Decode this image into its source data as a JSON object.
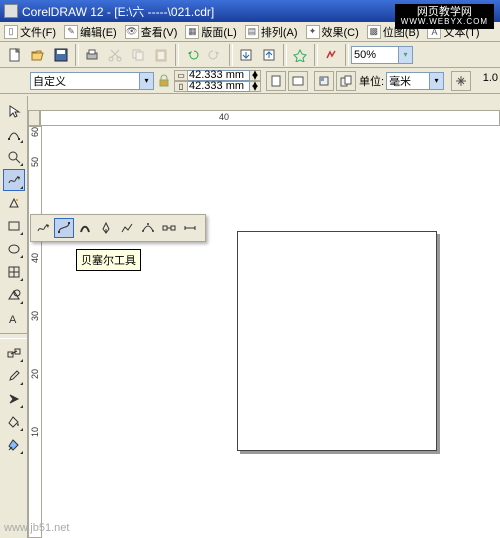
{
  "title": "CorelDRAW 12 - [E:\\六  -----\\021.cdr]",
  "menus": [
    {
      "label": "文件(F)",
      "icon": "file"
    },
    {
      "label": "编辑(E)",
      "icon": "edit"
    },
    {
      "label": "查看(V)",
      "icon": "view"
    },
    {
      "label": "版面(L)",
      "icon": "layout"
    },
    {
      "label": "排列(A)",
      "icon": "arrange"
    },
    {
      "label": "效果(C)",
      "icon": "effects"
    },
    {
      "label": "位图(B)",
      "icon": "bitmap"
    },
    {
      "label": "文本(T)",
      "icon": "text"
    }
  ],
  "toolbar": {
    "zoom": "50%"
  },
  "propbar": {
    "paper": "自定义",
    "width": "42.333 mm",
    "height": "42.333 mm",
    "units_label": "单位:",
    "units": "毫米",
    "far_value": "1.0"
  },
  "ruler_h": {
    "labels": [
      {
        "pos": 180,
        "text": "40"
      }
    ]
  },
  "ruler_v": {
    "labels": [
      {
        "pos": 2,
        "text": "60"
      },
      {
        "pos": 32,
        "text": "50"
      },
      {
        "pos": 128,
        "text": "40"
      },
      {
        "pos": 186,
        "text": "30"
      },
      {
        "pos": 244,
        "text": "20"
      },
      {
        "pos": 302,
        "text": "10"
      }
    ]
  },
  "tooltip": "贝塞尔工具",
  "watermark": {
    "line1": "网页教学网",
    "line2": "WWW.WEBYX.COM"
  },
  "watermark_bottom": "www.jb51.net"
}
